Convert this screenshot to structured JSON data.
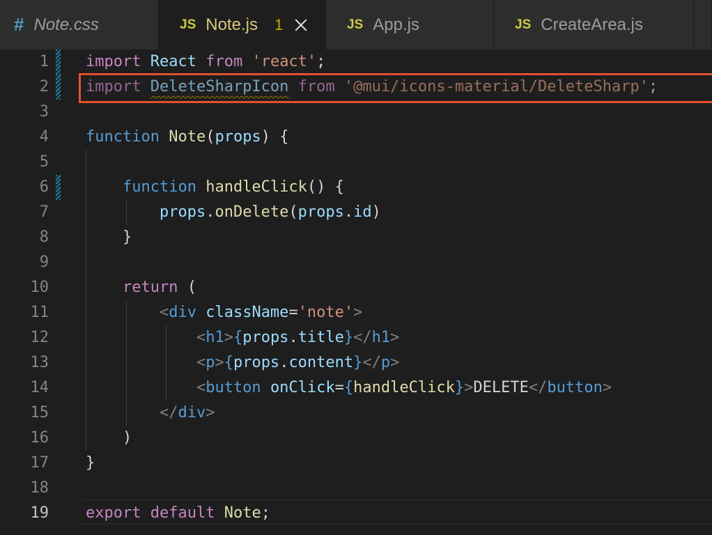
{
  "tabs": [
    {
      "icon": "#",
      "label": "Note.css"
    },
    {
      "icon": "JS",
      "label": "Note.js",
      "problems": "1"
    },
    {
      "icon": "JS",
      "label": "App.js"
    },
    {
      "icon": "JS",
      "label": "CreateArea.js"
    }
  ],
  "editor": {
    "line_numbers": [
      "1",
      "2",
      "3",
      "4",
      "5",
      "6",
      "7",
      "8",
      "9",
      "10",
      "11",
      "12",
      "13",
      "14",
      "15",
      "16",
      "17",
      "18",
      "19"
    ],
    "lines": {
      "l1": [
        "import",
        "React",
        "from",
        "'react'",
        ";"
      ],
      "l2": [
        "import",
        "DeleteSharpIcon",
        "from",
        "'@mui/icons-material/DeleteSharp'",
        ";"
      ],
      "l4": [
        "function",
        "Note",
        "(",
        "props",
        ")",
        "{"
      ],
      "l6": [
        "function",
        "handleClick",
        "()",
        "{"
      ],
      "l7": [
        "props",
        ".",
        "onDelete",
        "(",
        "props",
        ".",
        "id",
        ")"
      ],
      "l8": [
        "}"
      ],
      "l10": [
        "return",
        "("
      ],
      "l11": [
        "<",
        "div",
        "className",
        "=",
        "'note'",
        ">"
      ],
      "l12": [
        "<",
        "h1",
        ">",
        "{",
        "props",
        ".",
        "title",
        "}",
        "</",
        "h1",
        ">"
      ],
      "l13": [
        "<",
        "p",
        ">",
        "{",
        "props",
        ".",
        "content",
        "}",
        "</",
        "p",
        ">"
      ],
      "l14": [
        "<",
        "button",
        "onClick",
        "=",
        "{",
        "handleClick",
        "}",
        ">",
        "DELETE",
        "</",
        "button",
        ">"
      ],
      "l15": [
        "</",
        "div",
        ">"
      ],
      "l16": [
        ")"
      ],
      "l17": [
        "}"
      ],
      "l19": [
        "export",
        "default",
        "Note",
        ";"
      ]
    }
  },
  "colors": {
    "highlight_box": "#e4502f",
    "squiggle_warning": "#cca700",
    "git_modified": "#1b81a8"
  }
}
